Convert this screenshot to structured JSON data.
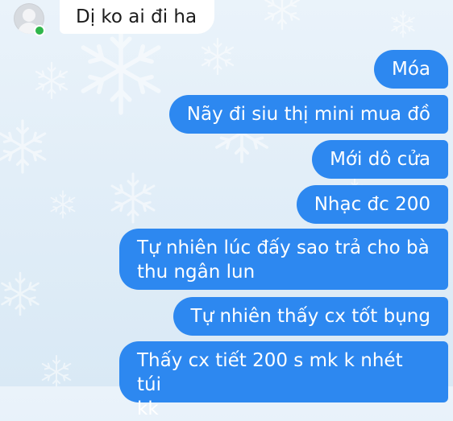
{
  "incoming_message": {
    "text": "Dị ko ai đi ha"
  },
  "outgoing_messages": [
    {
      "text": "Móa"
    },
    {
      "text": "Nãy đi siu thị mini mua đồ"
    },
    {
      "text": "Mới dô cửa"
    },
    {
      "text": "Nhạc đc 200"
    },
    {
      "lines": [
        "Tự nhiên lúc đấy sao trả cho bà",
        "thu ngân lun"
      ]
    },
    {
      "text": "Tự nhiên thấy cx tốt bụng"
    },
    {
      "lines": [
        "Thấy cx tiết 200 s mk k nhét túi",
        "kk"
      ]
    }
  ],
  "colors": {
    "outgoing_bubble": "#2d88f0",
    "incoming_bubble": "#ffffff",
    "online_indicator": "#2fb64b",
    "background": "#e2eef8"
  },
  "icons": {
    "avatar": "default-user-avatar",
    "online": "online-status-dot",
    "background": "snowflake-pattern"
  }
}
